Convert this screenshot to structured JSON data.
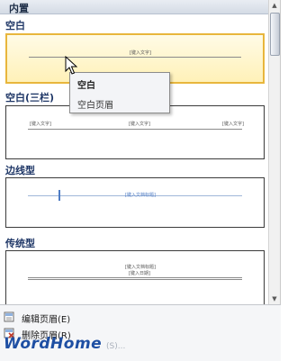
{
  "gallery": {
    "header": "内置",
    "sections": [
      {
        "title": "空白",
        "thumb_text": [
          "[键入文字]"
        ]
      },
      {
        "title": "空白(三栏)",
        "thumb_text": [
          "[键入文字]",
          "[键入文字]",
          "[键入文字]"
        ]
      },
      {
        "title": "边线型",
        "thumb_text": [
          "[键入文档标题]"
        ]
      },
      {
        "title": "传统型",
        "thumb_text": [
          "[键入文档标题]",
          "[键入日期]"
        ]
      }
    ]
  },
  "tooltip": {
    "title": "空白",
    "description": "空白页眉"
  },
  "menu": {
    "items": [
      {
        "label": "编辑页眉(E)"
      },
      {
        "label": "删除页眉(R)"
      }
    ]
  },
  "watermark": {
    "text": "WordHome",
    "tail": "(S)..."
  },
  "colors": {
    "selection": "#e8b63c",
    "accent_blue": "#1f3767"
  }
}
